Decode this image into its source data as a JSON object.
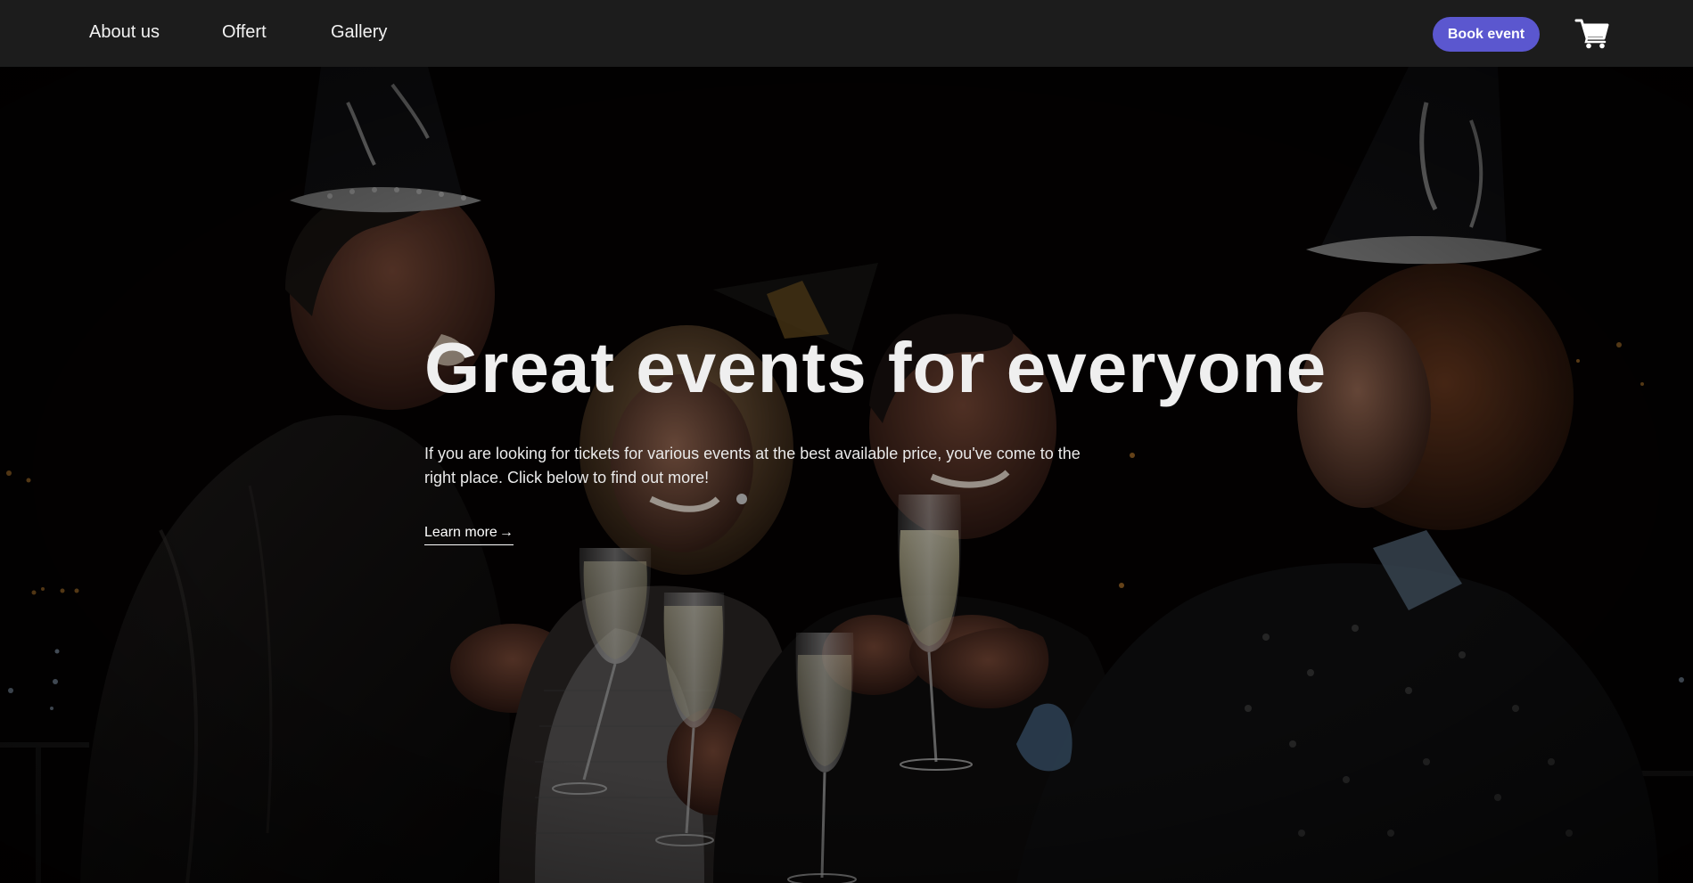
{
  "nav": {
    "links": [
      {
        "label": "About us"
      },
      {
        "label": "Offert"
      },
      {
        "label": "Gallery"
      }
    ],
    "book_button": "Book event",
    "cart_icon": "shopping-cart-icon"
  },
  "hero": {
    "title": "Great events for everyone",
    "description": "If you are looking for tickets for various events at the best available price, you've come to the right place. Click below to find out more!",
    "cta_label": "Learn more",
    "cta_arrow": "→",
    "background": "photo of four people toasting champagne glasses at night wearing New Year party hats"
  },
  "colors": {
    "nav_background": "#1c1c1c",
    "accent": "#5b57cf",
    "text": "#efefef"
  }
}
